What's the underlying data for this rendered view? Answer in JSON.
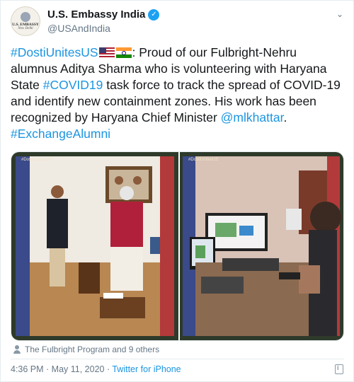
{
  "author": {
    "display_name": "U.S. Embassy India",
    "handle": "@USAndIndia",
    "avatar_line1": "U.S. EMBASSY",
    "avatar_line2": "New Delhi"
  },
  "tweet": {
    "hashtag_dosti": "#DostiUnitesUS",
    "text_1": ": Proud of our Fulbright-Nehru alumnus Aditya Sharma who is volunteering with Haryana State ",
    "hashtag_covid": "#COVID19",
    "text_2": " task force to track the spread of COVID-19 and identify new containment zones. His work has been recognized by Haryana Chief Minister ",
    "mention": "@mlkhattar",
    "text_3": ". ",
    "hashtag_exchange": "#ExchangeAlumni"
  },
  "media": {
    "photo_left_tag": "#DostiUnitesUS",
    "photo_right_tag": "#DostiUnitesUS"
  },
  "likes_text": "The Fulbright Program and 9 others",
  "footer": {
    "timestamp": "4:36 PM · May 11, 2020 · ",
    "source": "Twitter for iPhone"
  },
  "colors": {
    "link": "#1b95e0",
    "verified": "#1da1f2",
    "muted": "#657786"
  },
  "icons": {
    "verified": "verified-badge-icon",
    "caret": "chevron-down-icon",
    "person": "person-icon",
    "info": "info-icon"
  }
}
